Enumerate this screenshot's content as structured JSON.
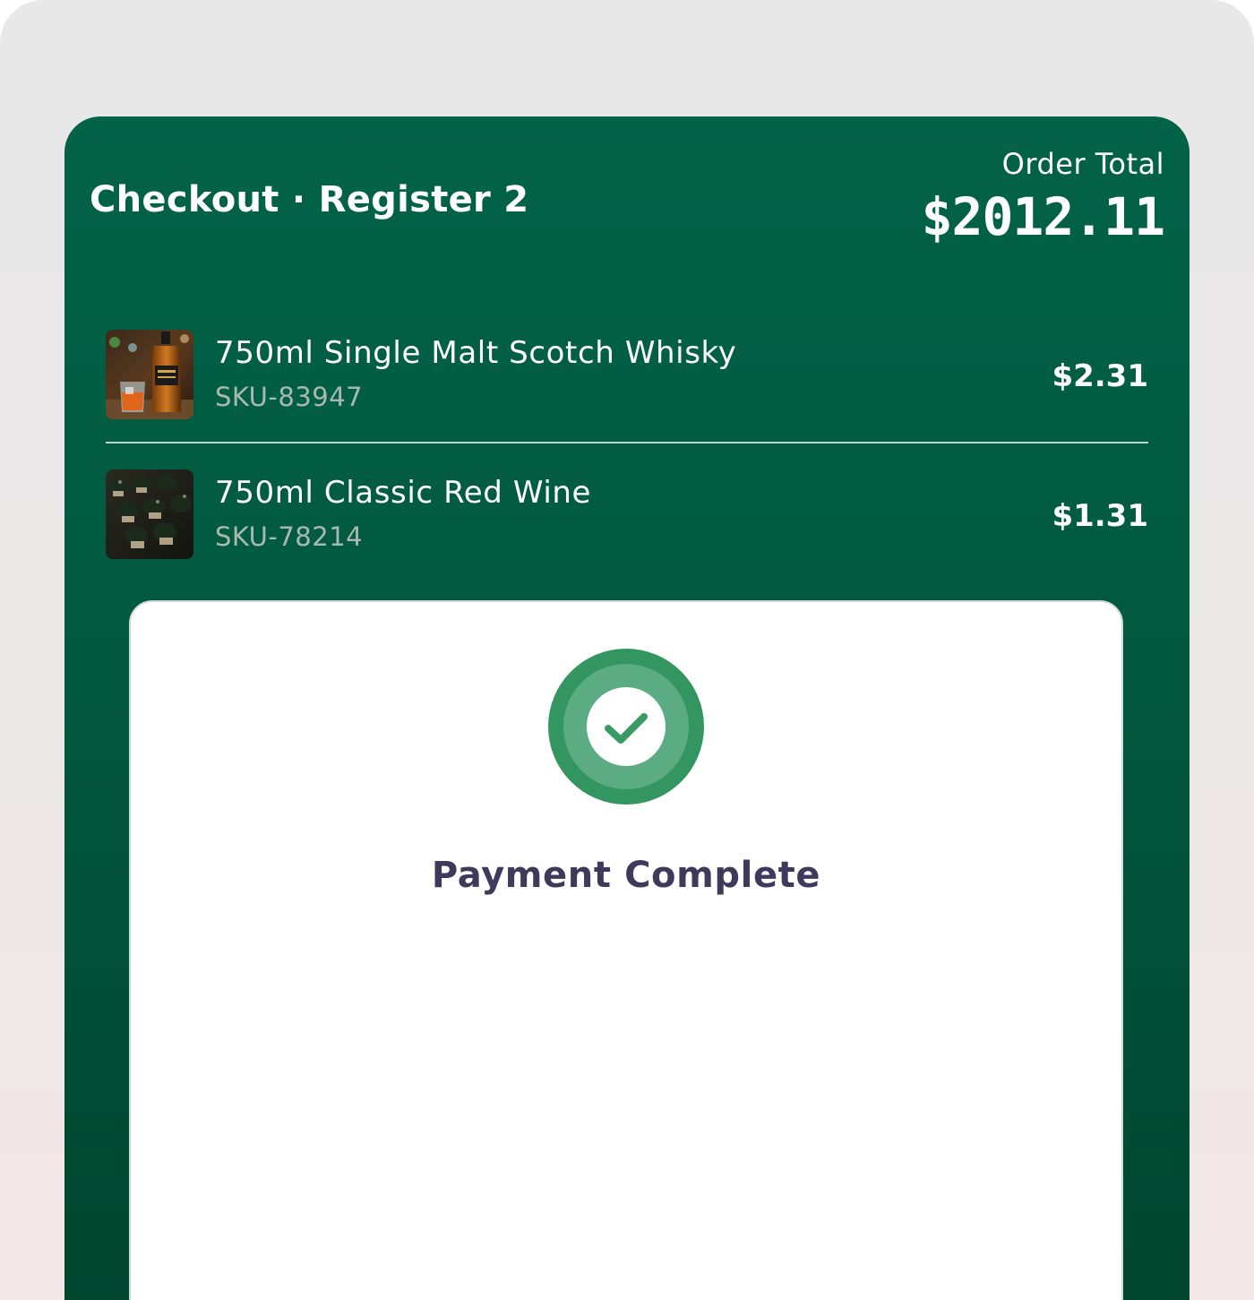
{
  "header": {
    "title": "Checkout · Register 2",
    "total_label": "Order Total",
    "total_amount": "$2012.11"
  },
  "cart": {
    "items": [
      {
        "name": "750ml Single Malt Scotch Whisky",
        "sku": "SKU-83947",
        "price": "$2.31",
        "thumbnail": "whisky-bottle-photo"
      },
      {
        "name": "750ml Classic Red Wine",
        "sku": "SKU-78214",
        "price": "$1.31",
        "thumbnail": "wine-bottles-photo"
      }
    ]
  },
  "payment": {
    "status": "Payment Complete",
    "icon": "checkmark-success-icon"
  },
  "colors": {
    "panel_top": "#036347",
    "panel_bottom": "#01462f",
    "success_green": "#33955f",
    "status_text": "#3d3a5c",
    "sku_text": "#a9b8b2"
  }
}
